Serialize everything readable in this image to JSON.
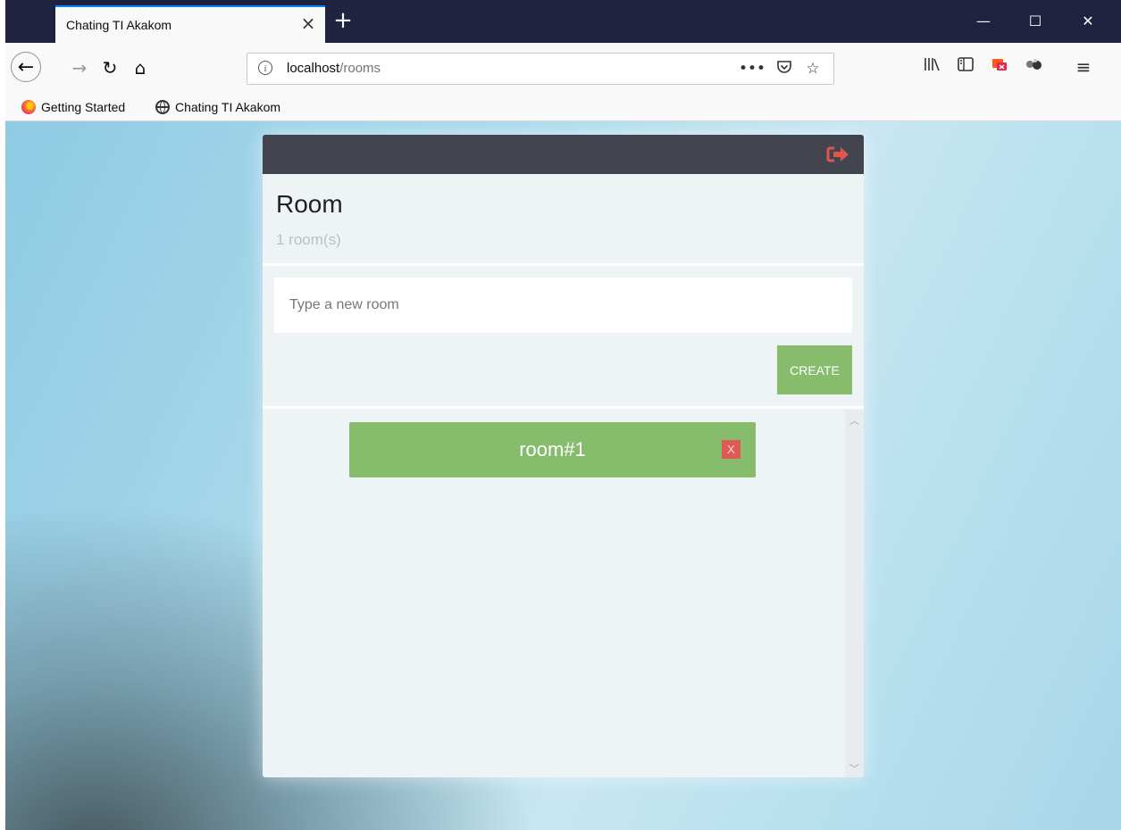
{
  "browser": {
    "tab_title": "Chating TI Akakom",
    "tab_close_glyph": "×",
    "new_tab_glyph": "+",
    "window_controls": {
      "minimize": "—",
      "maximize": "☐",
      "close": "✕"
    },
    "url_host": "localhost",
    "url_path": "/rooms",
    "bookmarks": [
      {
        "label": "Getting Started",
        "icon": "firefox-icon"
      },
      {
        "label": "Chating TI Akakom",
        "icon": "globe-icon"
      }
    ]
  },
  "app": {
    "title": "Room",
    "room_count": "1 room(s)",
    "input_placeholder": "Type a new room",
    "create_label": "CREATE",
    "rooms": [
      {
        "name": "room#1",
        "delete_label": "X"
      }
    ],
    "colors": {
      "header": "#42444f",
      "accent_green": "#86bc6c",
      "delete_red": "#e05a55",
      "logout_red": "#e0564f"
    }
  }
}
